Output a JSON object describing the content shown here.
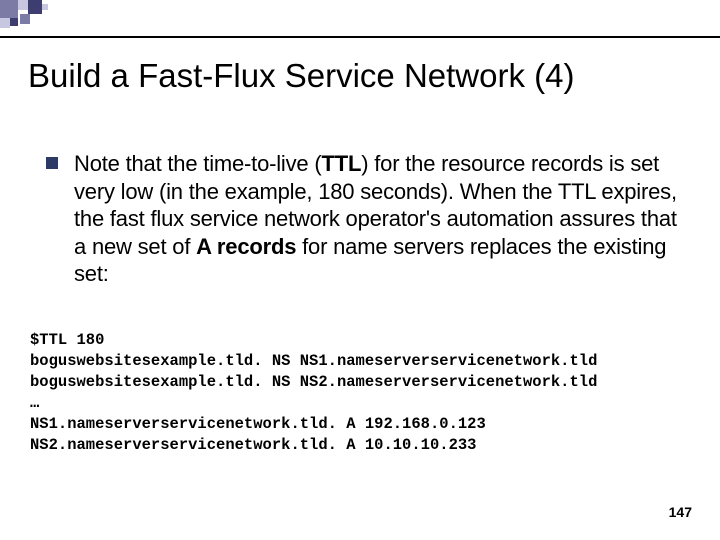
{
  "title": "Build a Fast-Flux Service Network (4)",
  "bullet_html": "Note that the time-to-live (<b>TTL</b>) for the resource records is set very low (in the example, 180 seconds). When the TTL expires, the fast flux service network operator's automation assures that a new set of <b>A records</b> for name servers replaces the existing set:",
  "code": "$TTL 180\nboguswebsitesexample.tld. NS NS1.nameserverservicenetwork.tld\nboguswebsitesexample.tld. NS NS2.nameserverservicenetwork.tld\n…\nNS1.nameserverservicenetwork.tld. A 192.168.0.123\nNS2.nameserverservicenetwork.tld. A 10.10.10.233",
  "page_number": "147",
  "deco": {
    "c1": "#7b7ba6",
    "c2": "#c7c7e0",
    "c3": "#3d3d70"
  }
}
